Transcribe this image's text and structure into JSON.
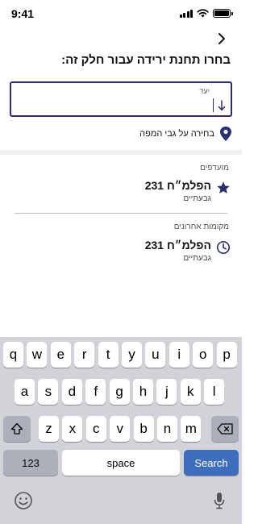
{
  "status_bar": {
    "time": "9:41"
  },
  "header": {
    "title": "בחרו תחנת ירידה עבור חלק זה:"
  },
  "destination_input": {
    "label": "יעד",
    "value": ""
  },
  "map_pick": {
    "label": "בחירה על גבי המפה"
  },
  "favorites": {
    "section_title": "מועדפים",
    "items": [
      {
        "name": "הפלמ״ח 231",
        "city": "גבעתיים"
      }
    ]
  },
  "recent": {
    "section_title": "מקומות אחרונים",
    "items": [
      {
        "name": "הפלמ״ח 231",
        "city": "גבעתיים"
      }
    ]
  },
  "keyboard": {
    "row1": [
      "q",
      "w",
      "e",
      "r",
      "t",
      "y",
      "u",
      "i",
      "o",
      "p"
    ],
    "row2": [
      "a",
      "s",
      "d",
      "f",
      "g",
      "h",
      "j",
      "k",
      "l"
    ],
    "row3": [
      "z",
      "x",
      "c",
      "v",
      "b",
      "n",
      "m"
    ],
    "numbers_label": "123",
    "space_label": "space",
    "search_label": "Search"
  },
  "colors": {
    "accent": "#2b2f6d",
    "search_key": "#3d6dbd",
    "keyboard_bg": "#d1d3d9"
  }
}
